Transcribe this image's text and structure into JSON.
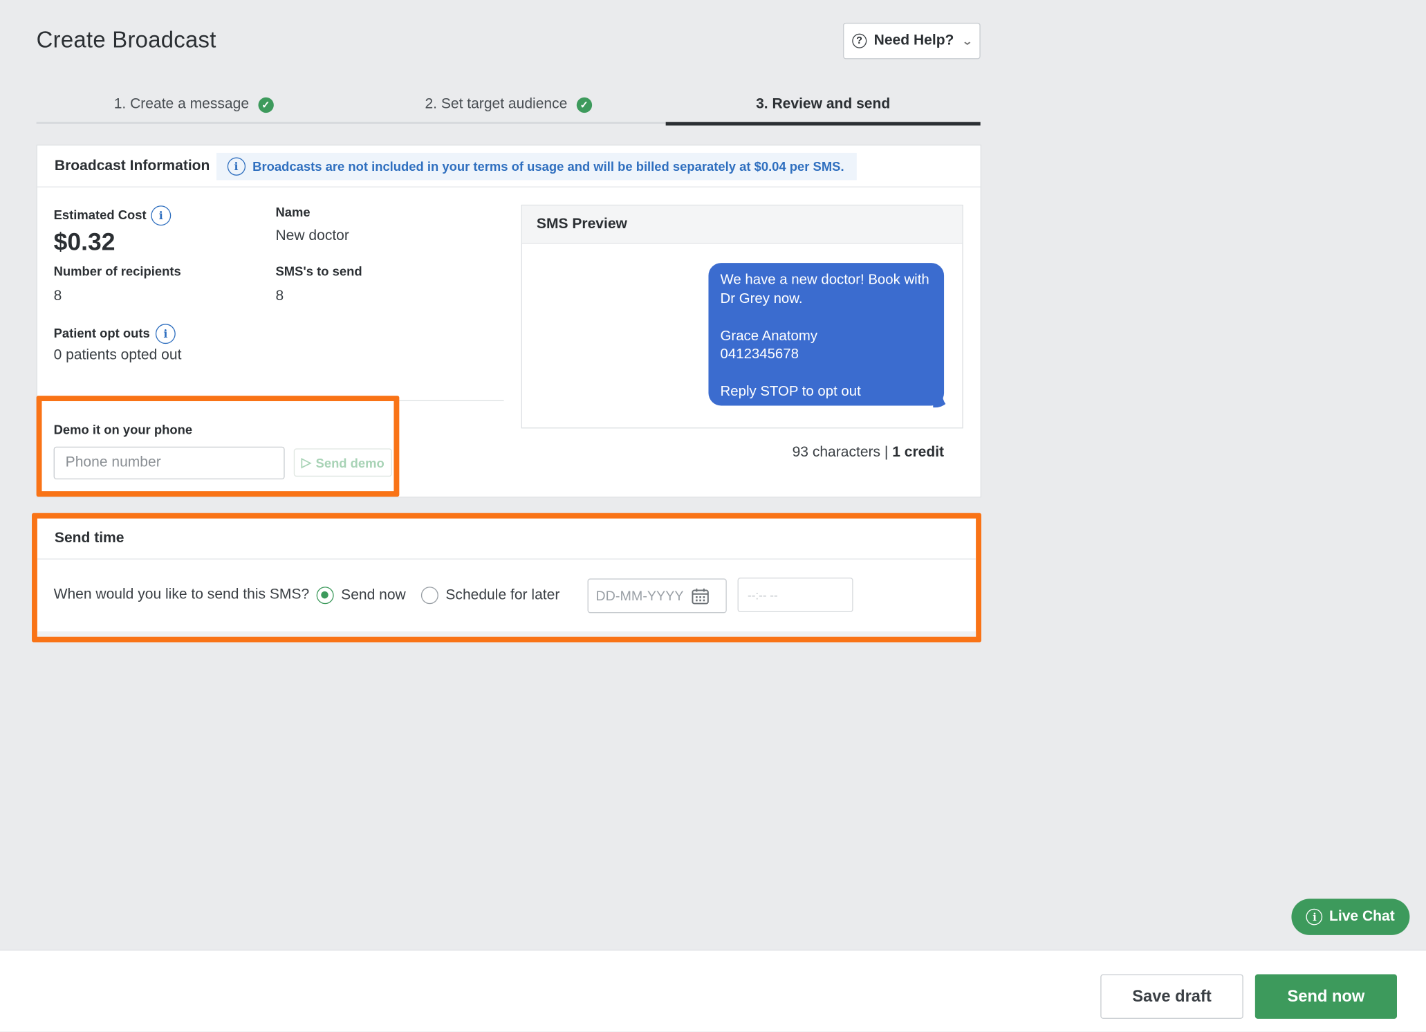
{
  "header": {
    "title": "Create Broadcast",
    "help_label": "Need Help?"
  },
  "steps": [
    {
      "label": "1. Create a message",
      "completed": true
    },
    {
      "label": "2. Set target audience",
      "completed": true
    },
    {
      "label": "3. Review and send",
      "active": true
    }
  ],
  "broadcast_info": {
    "title": "Broadcast Information",
    "notice": "Broadcasts are not included in your terms of usage and will be billed separately at $0.04 per SMS.",
    "estimated_cost_label": "Estimated Cost",
    "estimated_cost": "$0.32",
    "name_label": "Name",
    "name": "New doctor",
    "recipients_label": "Number of recipients",
    "recipients": "8",
    "sms_to_send_label": "SMS's to send",
    "sms_to_send": "8",
    "opt_outs_label": "Patient opt outs",
    "opt_outs": "0 patients opted out"
  },
  "demo": {
    "label": "Demo it on your phone",
    "phone_placeholder": "Phone number",
    "send_label": "Send demo"
  },
  "sms_preview": {
    "title": "SMS Preview",
    "message": "We have a new doctor! Book with Dr Grey now.\n\nGrace Anatomy\n0412345678\n\nReply STOP to opt out",
    "characters": "93 characters | ",
    "credits": "1 credit"
  },
  "send_time": {
    "title": "Send time",
    "question": "When would you like to send this SMS?",
    "option_now": "Send now",
    "option_later": "Schedule for later",
    "selected": "now",
    "date_placeholder": "DD-MM-YYYY",
    "time_placeholder": "--:-- --"
  },
  "live_chat": {
    "label": "Live Chat"
  },
  "footer": {
    "save_draft": "Save draft",
    "send_now": "Send now"
  },
  "colors": {
    "accent_green": "#3d9a5c",
    "bubble_blue": "#3b6ccf",
    "highlight_orange": "#f97316",
    "notice_blue": "#2f6fbf"
  }
}
